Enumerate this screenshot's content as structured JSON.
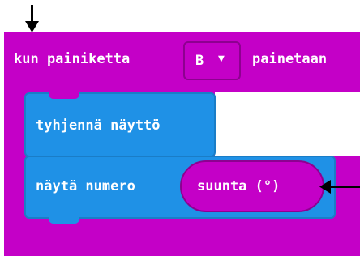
{
  "event_block": {
    "prefix": "kun painiketta",
    "button_value": "B",
    "suffix": "painetaan"
  },
  "blocks": {
    "clear_screen": "tyhjennä näyttö",
    "show_number": "näytä numero",
    "heading": "suunta (°)"
  },
  "colors": {
    "event": "#c400c7",
    "basic": "#1f91e6"
  }
}
